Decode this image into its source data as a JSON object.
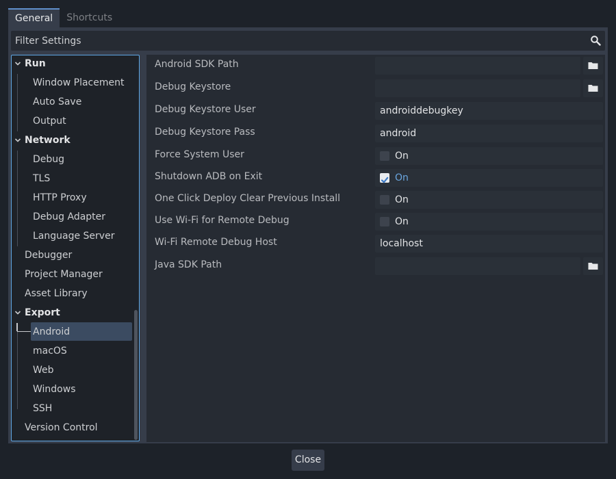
{
  "tabs": [
    {
      "label": "General",
      "active": true
    },
    {
      "label": "Shortcuts",
      "active": false
    }
  ],
  "filter": {
    "placeholder": "Filter Settings"
  },
  "tree": [
    {
      "label": "Run",
      "type": "category"
    },
    {
      "label": "Window Placement",
      "type": "child"
    },
    {
      "label": "Auto Save",
      "type": "child"
    },
    {
      "label": "Output",
      "type": "child"
    },
    {
      "label": "Network",
      "type": "category"
    },
    {
      "label": "Debug",
      "type": "child"
    },
    {
      "label": "TLS",
      "type": "child"
    },
    {
      "label": "HTTP Proxy",
      "type": "child"
    },
    {
      "label": "Debug Adapter",
      "type": "child"
    },
    {
      "label": "Language Server",
      "type": "child"
    },
    {
      "label": "Debugger",
      "type": "section"
    },
    {
      "label": "Project Manager",
      "type": "section"
    },
    {
      "label": "Asset Library",
      "type": "section"
    },
    {
      "label": "Export",
      "type": "category"
    },
    {
      "label": "Android",
      "type": "child",
      "selected": true
    },
    {
      "label": "macOS",
      "type": "child"
    },
    {
      "label": "Web",
      "type": "child"
    },
    {
      "label": "Windows",
      "type": "child"
    },
    {
      "label": "SSH",
      "type": "child"
    },
    {
      "label": "Version Control",
      "type": "section"
    }
  ],
  "properties": [
    {
      "label": "Android SDK Path",
      "type": "path",
      "value": ""
    },
    {
      "label": "Debug Keystore",
      "type": "path",
      "value": ""
    },
    {
      "label": "Debug Keystore User",
      "type": "text",
      "value": "androiddebugkey"
    },
    {
      "label": "Debug Keystore Pass",
      "type": "text",
      "value": "android"
    },
    {
      "label": "Force System User",
      "type": "bool",
      "checked": false,
      "value": "On"
    },
    {
      "label": "Shutdown ADB on Exit",
      "type": "bool",
      "checked": true,
      "value": "On"
    },
    {
      "label": "One Click Deploy Clear Previous Install",
      "type": "bool",
      "checked": false,
      "value": "On"
    },
    {
      "label": "Use Wi-Fi for Remote Debug",
      "type": "bool",
      "checked": false,
      "value": "On"
    },
    {
      "label": "Wi-Fi Remote Debug Host",
      "type": "text",
      "value": "localhost"
    },
    {
      "label": "Java SDK Path",
      "type": "path",
      "value": ""
    }
  ],
  "close_label": "Close",
  "icons": {
    "search": "search-icon",
    "folder": "folder-icon",
    "chevron": "chevron-down-icon",
    "check": "check-icon"
  },
  "colors": {
    "accent": "#5fa8e6",
    "selection": "#3b4b61",
    "on_text": "#6aa6e0"
  }
}
